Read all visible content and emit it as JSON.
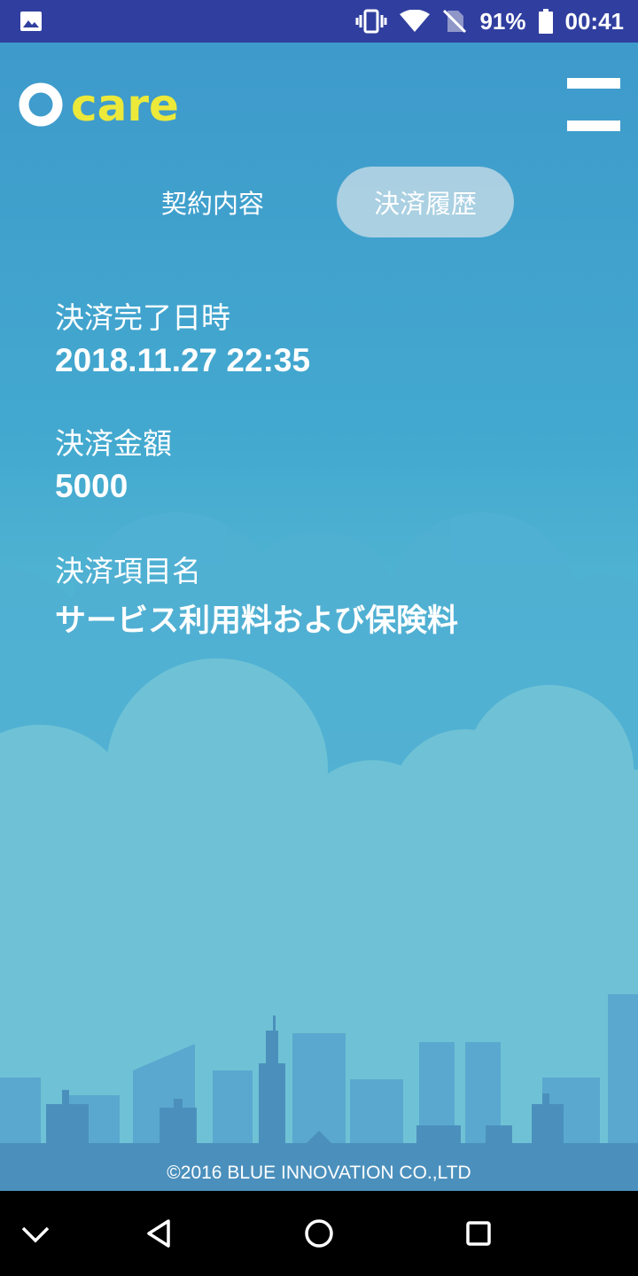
{
  "status_bar": {
    "battery_percent": "91%",
    "time": "00:41",
    "icons": [
      "gallery-icon",
      "vibrate-icon",
      "wifi-icon",
      "no-sim-icon",
      "battery-icon"
    ]
  },
  "header": {
    "logo_text": "care",
    "logo_color": "#ece93a",
    "menu_icon": "hamburger-menu-icon"
  },
  "tabs": [
    {
      "label": "契約内容",
      "selected": false
    },
    {
      "label": "決済履歴",
      "selected": true
    }
  ],
  "payment": {
    "completed_label": "決済完了日時",
    "completed_value": "2018.11.27 22:35",
    "amount_label": "決済金額",
    "amount_value": "5000",
    "item_label": "決済項目名",
    "item_value": "サービス利用料および保険料"
  },
  "footer": {
    "copyright": "©2016 BLUE INNOVATION CO.,LTD"
  },
  "nav_bar": {
    "icons": [
      "chevron-down-icon",
      "back-icon",
      "home-icon",
      "recents-icon"
    ]
  },
  "colors": {
    "status_bar": "#303f9f",
    "background_top": "#3e9acb",
    "background_bottom": "#75c9d4",
    "accent_yellow": "#ece93a"
  }
}
